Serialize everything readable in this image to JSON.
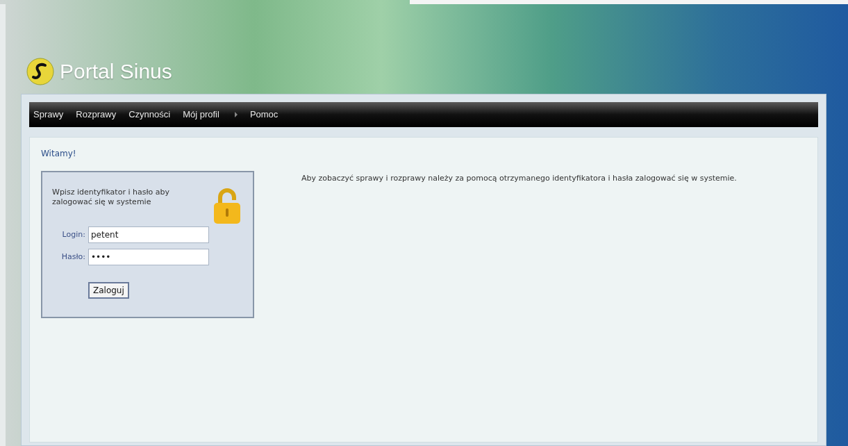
{
  "header": {
    "title": "Portal Sinus"
  },
  "nav": [
    {
      "label": "Sprawy",
      "has_submenu": false
    },
    {
      "label": "Rozprawy",
      "has_submenu": false
    },
    {
      "label": "Czynności",
      "has_submenu": false
    },
    {
      "label": "Mój profil",
      "has_submenu": true
    },
    {
      "label": "Pomoc",
      "has_submenu": false
    }
  ],
  "page_title": "Witamy!",
  "login_box": {
    "instruction": "Wpisz identyfikator i hasło aby zalogować się w systemie",
    "login_label": "Login:",
    "login_value": "petent",
    "password_label": "Hasło:",
    "password_value": "••••",
    "submit": "Zaloguj"
  },
  "info_text": "Aby zobaczyć sprawy i rozprawy należy za pomocą otrzymanego identyfikatora i hasła zalogować się w systemie."
}
